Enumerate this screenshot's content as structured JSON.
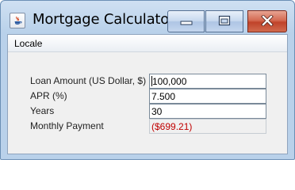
{
  "window": {
    "title": "Mortgage Calculator",
    "controls": {
      "minimize": "minimize-icon",
      "maximize": "maximize-icon",
      "close": "close-icon"
    }
  },
  "menubar": {
    "items": [
      {
        "label": "Locale"
      }
    ]
  },
  "form": {
    "fields": [
      {
        "label": "Loan Amount (US Dollar, $)",
        "value": "100,000"
      },
      {
        "label": "APR (%)",
        "value": "7.500"
      },
      {
        "label": "Years",
        "value": "30"
      },
      {
        "label": "Monthly Payment",
        "value": "($699.21)"
      }
    ]
  },
  "colors": {
    "payment_text": "#c00000",
    "close_button": "#c0432a",
    "title_bar": "#b9d1ea"
  }
}
